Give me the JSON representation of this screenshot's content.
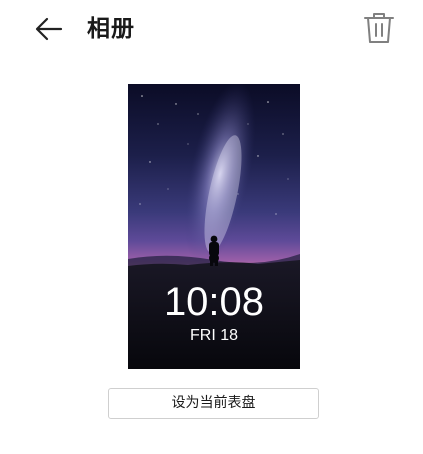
{
  "header": {
    "title": "相册",
    "back_icon": "arrow-left-icon",
    "delete_icon": "trash-icon"
  },
  "watchface": {
    "time": "10:08",
    "date": "FRI 18",
    "background": "milky-way-silhouette-image"
  },
  "actions": {
    "set_current_label": "设为当前表盘"
  },
  "colors": {
    "text_primary": "#1a1a1a",
    "icon_gray": "#808080",
    "button_border": "#cfcfcf"
  }
}
